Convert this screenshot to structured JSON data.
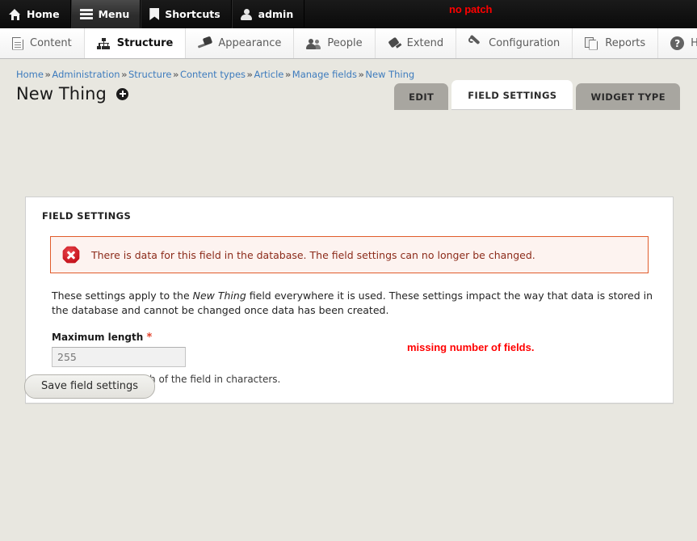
{
  "toolbar": {
    "items": [
      {
        "label": "Home",
        "icon": "home-icon",
        "active": false
      },
      {
        "label": "Menu",
        "icon": "hamburger-menu-icon",
        "active": true
      },
      {
        "label": "Shortcuts",
        "icon": "bookmark-icon",
        "active": false
      },
      {
        "label": "admin",
        "icon": "user-icon",
        "active": false
      }
    ],
    "annotation": "no patch",
    "annotation_color": "#ff0000"
  },
  "admin_menu": {
    "items": [
      {
        "label": "Content",
        "icon": "document-icon",
        "active": false
      },
      {
        "label": "Structure",
        "icon": "sitemap-icon",
        "active": true
      },
      {
        "label": "Appearance",
        "icon": "paintbrush-icon",
        "active": false
      },
      {
        "label": "People",
        "icon": "people-icon",
        "active": false
      },
      {
        "label": "Extend",
        "icon": "plug-icon",
        "active": false
      },
      {
        "label": "Configuration",
        "icon": "wrench-icon",
        "active": false
      },
      {
        "label": "Reports",
        "icon": "documents-icon",
        "active": false
      },
      {
        "label": "Help",
        "icon": "question-mark-icon",
        "active": false
      }
    ],
    "toggle_icon": "collapse-toolbar-icon"
  },
  "breadcrumb": {
    "separator": "»",
    "items": [
      "Home",
      "Administration",
      "Structure",
      "Content types",
      "Article",
      "Manage fields",
      "New Thing"
    ]
  },
  "page": {
    "title": "New Thing",
    "contextual_icon": "add-circle-icon"
  },
  "tabs": [
    {
      "label": "EDIT",
      "active": false
    },
    {
      "label": "FIELD SETTINGS",
      "active": true
    },
    {
      "label": "WIDGET TYPE",
      "active": false
    }
  ],
  "panel": {
    "legend": "FIELD SETTINGS",
    "error": {
      "icon": "error-octagon-icon",
      "text": "There is data for this field in the database. The field settings can no longer be changed.",
      "border_color": "#e05c2b",
      "background_color": "#fdf3f0",
      "text_color": "#8c2b1a"
    },
    "description_part1": "These settings apply to the ",
    "description_emphasis": "New Thing",
    "description_part2": " field everywhere it is used. These settings impact the way that data is stored in the database and cannot be changed once data has been created.",
    "field": {
      "label": "Maximum length",
      "required_marker": "*",
      "value": "255",
      "placeholder": "255",
      "description": "The maximum length of the field in characters.",
      "annotation": "missing number of fields.",
      "annotation_color": "#ff0000"
    }
  },
  "actions": {
    "save_label": "Save field settings"
  }
}
